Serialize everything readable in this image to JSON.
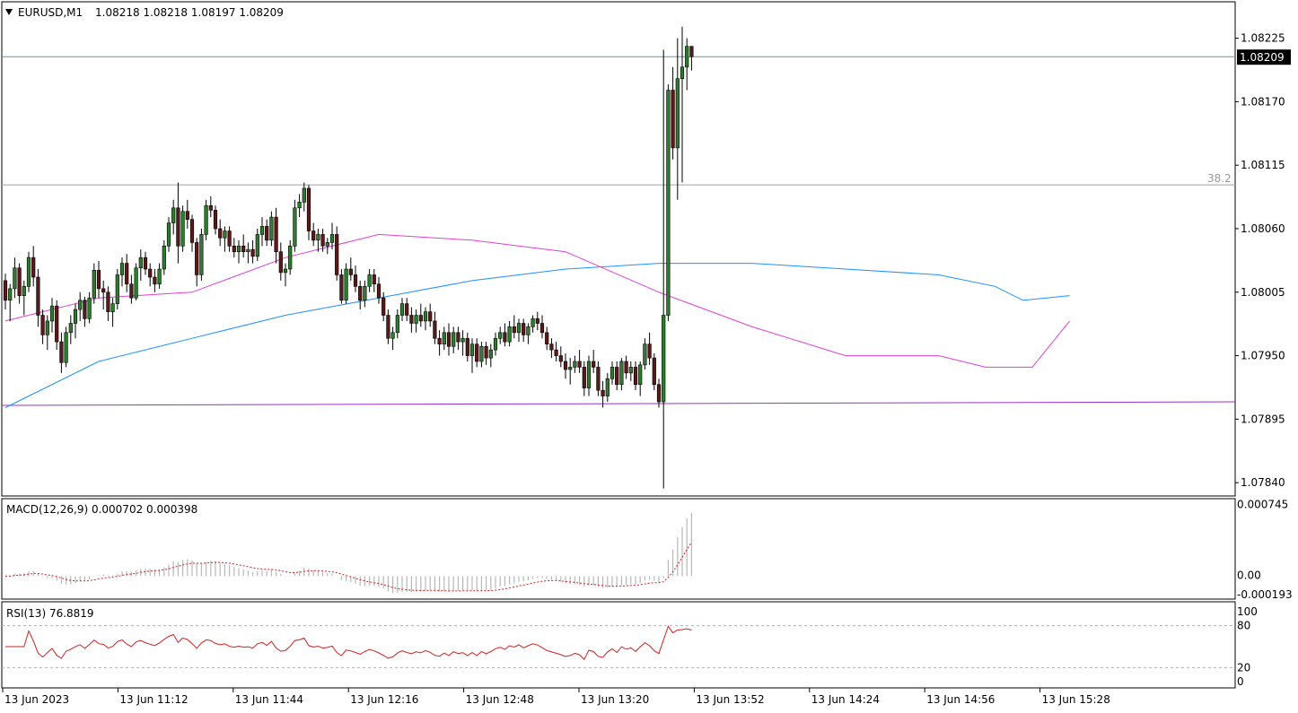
{
  "header": {
    "symbol": "EURUSD,M1",
    "ohlc": "1.08218 1.08218 1.08197 1.08209"
  },
  "chart_data": [
    {
      "type": "candlestick",
      "symbol": "EURUSD",
      "timeframe": "M1",
      "price_axis_ticks": [
        "1.08225",
        "1.08170",
        "1.08115",
        "1.08060",
        "1.08005",
        "1.07950",
        "1.07895",
        "1.07840"
      ],
      "ylim": [
        1.0783,
        1.08255
      ],
      "current_price": "1.08209",
      "current_price_value": 1.08209,
      "fib_level": {
        "label": "38.2",
        "value": 1.08098
      },
      "horizontal_line_value": 1.0791,
      "candles": [
        [
          1.08015,
          1.08021,
          1.0799,
          1.07998
        ],
        [
          1.07998,
          1.08012,
          1.0798,
          1.08008
        ],
        [
          1.08008,
          1.08035,
          1.08,
          1.08026
        ],
        [
          1.08026,
          1.0803,
          1.07995,
          1.08002
        ],
        [
          1.08002,
          1.08015,
          1.07985,
          1.0801
        ],
        [
          1.0801,
          1.0804,
          1.08005,
          1.08035
        ],
        [
          1.08035,
          1.08045,
          1.0801,
          1.08018
        ],
        [
          1.08018,
          1.08025,
          1.07975,
          1.07985
        ],
        [
          1.07985,
          1.0799,
          1.0796,
          1.07968
        ],
        [
          1.07968,
          1.07985,
          1.07955,
          1.0798
        ],
        [
          1.0798,
          1.08,
          1.0797,
          1.07993
        ],
        [
          1.07993,
          1.07998,
          1.07955,
          1.07962
        ],
        [
          1.07962,
          1.0797,
          1.07935,
          1.07944
        ],
        [
          1.07944,
          1.07975,
          1.0794,
          1.0797
        ],
        [
          1.0797,
          1.07985,
          1.0796,
          1.07978
        ],
        [
          1.07978,
          1.07995,
          1.07965,
          1.0799
        ],
        [
          1.0799,
          1.08005,
          1.0798,
          1.07998
        ],
        [
          1.07998,
          1.08001,
          1.07975,
          1.07982
        ],
        [
          1.07982,
          1.08005,
          1.07978,
          1.08
        ],
        [
          1.08,
          1.0803,
          1.07995,
          1.08024
        ],
        [
          1.08024,
          1.08032,
          1.08,
          1.08008
        ],
        [
          1.08008,
          1.08015,
          1.0799,
          1.08005
        ],
        [
          1.08005,
          1.0801,
          1.0798,
          1.07988
        ],
        [
          1.07988,
          1.08,
          1.07975,
          1.07995
        ],
        [
          1.07995,
          1.08025,
          1.0799,
          1.0802
        ],
        [
          1.0802,
          1.08035,
          1.0801,
          1.0803
        ],
        [
          1.0803,
          1.08038,
          1.08005,
          1.08012
        ],
        [
          1.08012,
          1.0802,
          1.07995,
          1.08
        ],
        [
          1.08,
          1.0803,
          1.07998,
          1.08026
        ],
        [
          1.08026,
          1.08042,
          1.08015,
          1.08035
        ],
        [
          1.08035,
          1.0804,
          1.0802,
          1.08025
        ],
        [
          1.08025,
          1.0803,
          1.0801,
          1.08018
        ],
        [
          1.08018,
          1.08025,
          1.08005,
          1.08012
        ],
        [
          1.08012,
          1.0803,
          1.08008,
          1.08025
        ],
        [
          1.08025,
          1.0805,
          1.0802,
          1.08045
        ],
        [
          1.08045,
          1.0807,
          1.0804,
          1.08065
        ],
        [
          1.08065,
          1.08085,
          1.08055,
          1.08078
        ],
        [
          1.08078,
          1.081,
          1.0803,
          1.08045
        ],
        [
          1.08045,
          1.0808,
          1.0804,
          1.08075
        ],
        [
          1.08075,
          1.08085,
          1.0806,
          1.08068
        ],
        [
          1.08068,
          1.08072,
          1.0804,
          1.08048
        ],
        [
          1.08048,
          1.08052,
          1.0801,
          1.0802
        ],
        [
          1.0802,
          1.0806,
          1.08015,
          1.08055
        ],
        [
          1.08055,
          1.08085,
          1.0805,
          1.0808
        ],
        [
          1.0808,
          1.08088,
          1.0807,
          1.08076
        ],
        [
          1.08076,
          1.0808,
          1.08055,
          1.0806
        ],
        [
          1.0806,
          1.08068,
          1.08045,
          1.08052
        ],
        [
          1.08052,
          1.08062,
          1.0804,
          1.08058
        ],
        [
          1.08058,
          1.08062,
          1.0804,
          1.08045
        ],
        [
          1.08045,
          1.08052,
          1.08035,
          1.0804
        ],
        [
          1.0804,
          1.0805,
          1.0803,
          1.08045
        ],
        [
          1.08045,
          1.08055,
          1.08035,
          1.0804
        ],
        [
          1.0804,
          1.08048,
          1.0803,
          1.08042
        ],
        [
          1.08042,
          1.0805,
          1.0803,
          1.08036
        ],
        [
          1.08036,
          1.0806,
          1.08032,
          1.08055
        ],
        [
          1.08055,
          1.0807,
          1.08045,
          1.08062
        ],
        [
          1.08062,
          1.08068,
          1.08045,
          1.0805
        ],
        [
          1.0805,
          1.08075,
          1.08045,
          1.0807
        ],
        [
          1.0807,
          1.08078,
          1.0803,
          1.0804
        ],
        [
          1.0804,
          1.08048,
          1.08015,
          1.08022
        ],
        [
          1.08022,
          1.0803,
          1.0801,
          1.08025
        ],
        [
          1.08025,
          1.0805,
          1.0802,
          1.08045
        ],
        [
          1.08045,
          1.08085,
          1.0804,
          1.08078
        ],
        [
          1.08078,
          1.0809,
          1.0807,
          1.08083
        ],
        [
          1.08083,
          1.081,
          1.08075,
          1.08095
        ],
        [
          1.08095,
          1.08098,
          1.0805,
          1.08058
        ],
        [
          1.08058,
          1.08065,
          1.08045,
          1.0805
        ],
        [
          1.0805,
          1.0806,
          1.0804,
          1.08055
        ],
        [
          1.08055,
          1.0806,
          1.0804,
          1.08045
        ],
        [
          1.08045,
          1.08052,
          1.08038,
          1.08048
        ],
        [
          1.08048,
          1.08065,
          1.08042,
          1.08055
        ],
        [
          1.08055,
          1.08062,
          1.08015,
          1.0802
        ],
        [
          1.0802,
          1.08025,
          1.07995,
          1.07998
        ],
        [
          1.07998,
          1.0803,
          1.07995,
          1.08025
        ],
        [
          1.08025,
          1.08035,
          1.08015,
          1.0802
        ],
        [
          1.0802,
          1.08028,
          1.08005,
          1.0801
        ],
        [
          1.0801,
          1.08015,
          1.0799,
          1.07998
        ],
        [
          1.07998,
          1.08015,
          1.07992,
          1.0801
        ],
        [
          1.0801,
          1.08025,
          1.08005,
          1.0802
        ],
        [
          1.0802,
          1.08025,
          1.08005,
          1.08012
        ],
        [
          1.08012,
          1.08018,
          1.07995,
          1.08
        ],
        [
          1.08,
          1.08005,
          1.0798,
          1.07985
        ],
        [
          1.07985,
          1.0799,
          1.0796,
          1.07965
        ],
        [
          1.07965,
          1.07975,
          1.07955,
          1.0797
        ],
        [
          1.0797,
          1.0799,
          1.07965,
          1.07985
        ],
        [
          1.07985,
          1.08,
          1.0798,
          1.07995
        ],
        [
          1.07995,
          1.08,
          1.0798,
          1.07985
        ],
        [
          1.07985,
          1.07992,
          1.0797,
          1.07978
        ],
        [
          1.07978,
          1.0799,
          1.0797,
          1.07985
        ],
        [
          1.07985,
          1.07995,
          1.07975,
          1.0798
        ],
        [
          1.0798,
          1.07992,
          1.07972,
          1.07988
        ],
        [
          1.07988,
          1.07995,
          1.07975,
          1.0798
        ],
        [
          1.0798,
          1.07988,
          1.0796,
          1.07965
        ],
        [
          1.07965,
          1.07972,
          1.0795,
          1.0796
        ],
        [
          1.0796,
          1.07975,
          1.07955,
          1.0797
        ],
        [
          1.0797,
          1.07978,
          1.0795,
          1.07958
        ],
        [
          1.07958,
          1.07975,
          1.07952,
          1.0797
        ],
        [
          1.0797,
          1.07975,
          1.07955,
          1.07962
        ],
        [
          1.07962,
          1.07972,
          1.0795,
          1.07965
        ],
        [
          1.07965,
          1.0797,
          1.07945,
          1.0795
        ],
        [
          1.0795,
          1.07965,
          1.07935,
          1.0796
        ],
        [
          1.0796,
          1.07965,
          1.0794,
          1.07945
        ],
        [
          1.07945,
          1.07962,
          1.0794,
          1.07958
        ],
        [
          1.07958,
          1.07962,
          1.07942,
          1.07948
        ],
        [
          1.07948,
          1.0796,
          1.0794,
          1.07955
        ],
        [
          1.07955,
          1.0797,
          1.0795,
          1.07965
        ],
        [
          1.07965,
          1.07975,
          1.0796,
          1.0797
        ],
        [
          1.0797,
          1.07978,
          1.07958,
          1.07962
        ],
        [
          1.07962,
          1.0798,
          1.07958,
          1.07975
        ],
        [
          1.07975,
          1.07985,
          1.07965,
          1.0797
        ],
        [
          1.0797,
          1.07982,
          1.07962,
          1.07978
        ],
        [
          1.07978,
          1.07982,
          1.07962,
          1.07968
        ],
        [
          1.07968,
          1.07978,
          1.0796,
          1.07975
        ],
        [
          1.07975,
          1.07985,
          1.0797,
          1.07982
        ],
        [
          1.07982,
          1.07988,
          1.07972,
          1.07978
        ],
        [
          1.07978,
          1.07985,
          1.07965,
          1.0797
        ],
        [
          1.0797,
          1.07975,
          1.07955,
          1.0796
        ],
        [
          1.0796,
          1.07965,
          1.07948,
          1.07955
        ],
        [
          1.07955,
          1.07962,
          1.07945,
          1.0795
        ],
        [
          1.0795,
          1.07958,
          1.0794,
          1.07945
        ],
        [
          1.07945,
          1.07952,
          1.0793,
          1.07938
        ],
        [
          1.07938,
          1.07948,
          1.07925,
          1.0794
        ],
        [
          1.0794,
          1.0795,
          1.07935,
          1.07945
        ],
        [
          1.07945,
          1.07955,
          1.07935,
          1.0794
        ],
        [
          1.0794,
          1.07945,
          1.07915,
          1.07922
        ],
        [
          1.07922,
          1.0795,
          1.07915,
          1.07945
        ],
        [
          1.07945,
          1.07955,
          1.07935,
          1.0794
        ],
        [
          1.0794,
          1.07945,
          1.07915,
          1.0792
        ],
        [
          1.0792,
          1.07928,
          1.07905,
          1.07915
        ],
        [
          1.07915,
          1.07935,
          1.0791,
          1.0793
        ],
        [
          1.0793,
          1.07945,
          1.07925,
          1.0794
        ],
        [
          1.0794,
          1.07945,
          1.0792,
          1.07925
        ],
        [
          1.07925,
          1.07948,
          1.0792,
          1.07945
        ],
        [
          1.07945,
          1.0795,
          1.0793,
          1.07935
        ],
        [
          1.07935,
          1.07945,
          1.07928,
          1.0794
        ],
        [
          1.0794,
          1.07945,
          1.0792,
          1.07925
        ],
        [
          1.07925,
          1.07945,
          1.07915,
          1.07942
        ],
        [
          1.07942,
          1.07965,
          1.07938,
          1.0796
        ],
        [
          1.0796,
          1.0797,
          1.07942,
          1.07948
        ],
        [
          1.07948,
          1.07952,
          1.0792,
          1.07925
        ],
        [
          1.07925,
          1.0793,
          1.07905,
          1.0791
        ],
        [
          1.0791,
          1.08215,
          1.07835,
          1.07985
        ],
        [
          1.07985,
          1.08185,
          1.0798,
          1.0818
        ],
        [
          1.0818,
          1.082,
          1.0812,
          1.0813
        ],
        [
          1.0813,
          1.08225,
          1.08085,
          1.0819
        ],
        [
          1.0819,
          1.08235,
          1.081,
          1.082
        ],
        [
          1.082,
          1.08225,
          1.0818,
          1.08218
        ],
        [
          1.08218,
          1.08218,
          1.08197,
          1.08209
        ]
      ],
      "ma_slow": [
        [
          0,
          1.07905
        ],
        [
          20,
          1.07945
        ],
        [
          40,
          1.07965
        ],
        [
          60,
          1.07985
        ],
        [
          80,
          1.08
        ],
        [
          100,
          1.08015
        ],
        [
          120,
          1.08025
        ],
        [
          140,
          1.0803
        ],
        [
          160,
          1.0803
        ],
        [
          180,
          1.08025
        ],
        [
          200,
          1.0802
        ],
        [
          212,
          1.0801
        ],
        [
          218,
          1.07998
        ],
        [
          228,
          1.08002
        ]
      ],
      "ma_fast": [
        [
          0,
          1.0798
        ],
        [
          20,
          1.08
        ],
        [
          40,
          1.08005
        ],
        [
          60,
          1.08035
        ],
        [
          80,
          1.08055
        ],
        [
          100,
          1.0805
        ],
        [
          120,
          1.0804
        ],
        [
          140,
          1.08005
        ],
        [
          160,
          1.07975
        ],
        [
          180,
          1.0795
        ],
        [
          200,
          1.0795
        ],
        [
          210,
          1.0794
        ],
        [
          220,
          1.0794
        ],
        [
          228,
          1.0798
        ]
      ],
      "macd": {
        "label": "MACD(12,26,9) 0.000702 0.000398",
        "ticks": [
          "0.000745",
          "0.00",
          "-0.000193"
        ],
        "ylim": [
          -0.00022,
          0.00077
        ]
      },
      "rsi": {
        "label": "RSI(13) 76.8819",
        "ticks": [
          "100",
          "80",
          "20",
          "0"
        ],
        "levels": [
          80,
          20
        ],
        "ylim": [
          0,
          100
        ]
      },
      "time_axis_labels": [
        "13 Jun 2023",
        "13 Jun 11:12",
        "13 Jun 11:44",
        "13 Jun 12:16",
        "13 Jun 12:48",
        "13 Jun 13:20",
        "13 Jun 13:52",
        "13 Jun 14:24",
        "13 Jun 14:56",
        "13 Jun 15:28"
      ],
      "colors": {
        "bull": "#2e7d2e",
        "bear": "#5a1a1a",
        "ma_slow": "#1e90ff",
        "ma_fast": "#e040d0",
        "hline": "#9b30c8",
        "signal": "#d42020",
        "rsi": "#d42020"
      }
    }
  ]
}
